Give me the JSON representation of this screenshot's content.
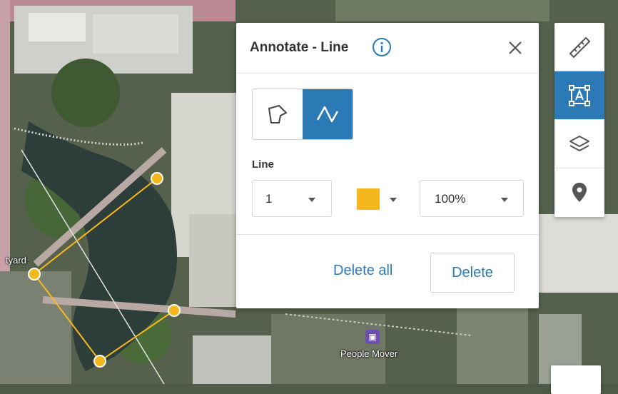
{
  "map": {
    "labels": {
      "courtyard": "tyard",
      "people_mover": "People Mover"
    },
    "annotation_color": "#f5b81c"
  },
  "dialog": {
    "title": "Annotate - Line",
    "info_icon": "info-icon",
    "close_icon": "close-icon",
    "modes": [
      {
        "name": "polygon",
        "icon": "polygon-icon",
        "active": false
      },
      {
        "name": "line",
        "icon": "line-icon",
        "active": true
      }
    ],
    "line_section_label": "Line",
    "line_width": "1",
    "line_color": "#f5b81c",
    "opacity": "100%",
    "delete_all_label": "Delete all",
    "delete_label": "Delete"
  },
  "toolbar": {
    "tools": [
      {
        "name": "measure",
        "icon": "ruler-icon",
        "active": false
      },
      {
        "name": "annotate",
        "icon": "text-annotate-icon",
        "active": true
      },
      {
        "name": "layers",
        "icon": "layers-icon",
        "active": false
      },
      {
        "name": "place",
        "icon": "location-pin-icon",
        "active": false
      }
    ]
  },
  "colors": {
    "accent": "#2b7ab6",
    "annotation": "#f5b81c"
  }
}
